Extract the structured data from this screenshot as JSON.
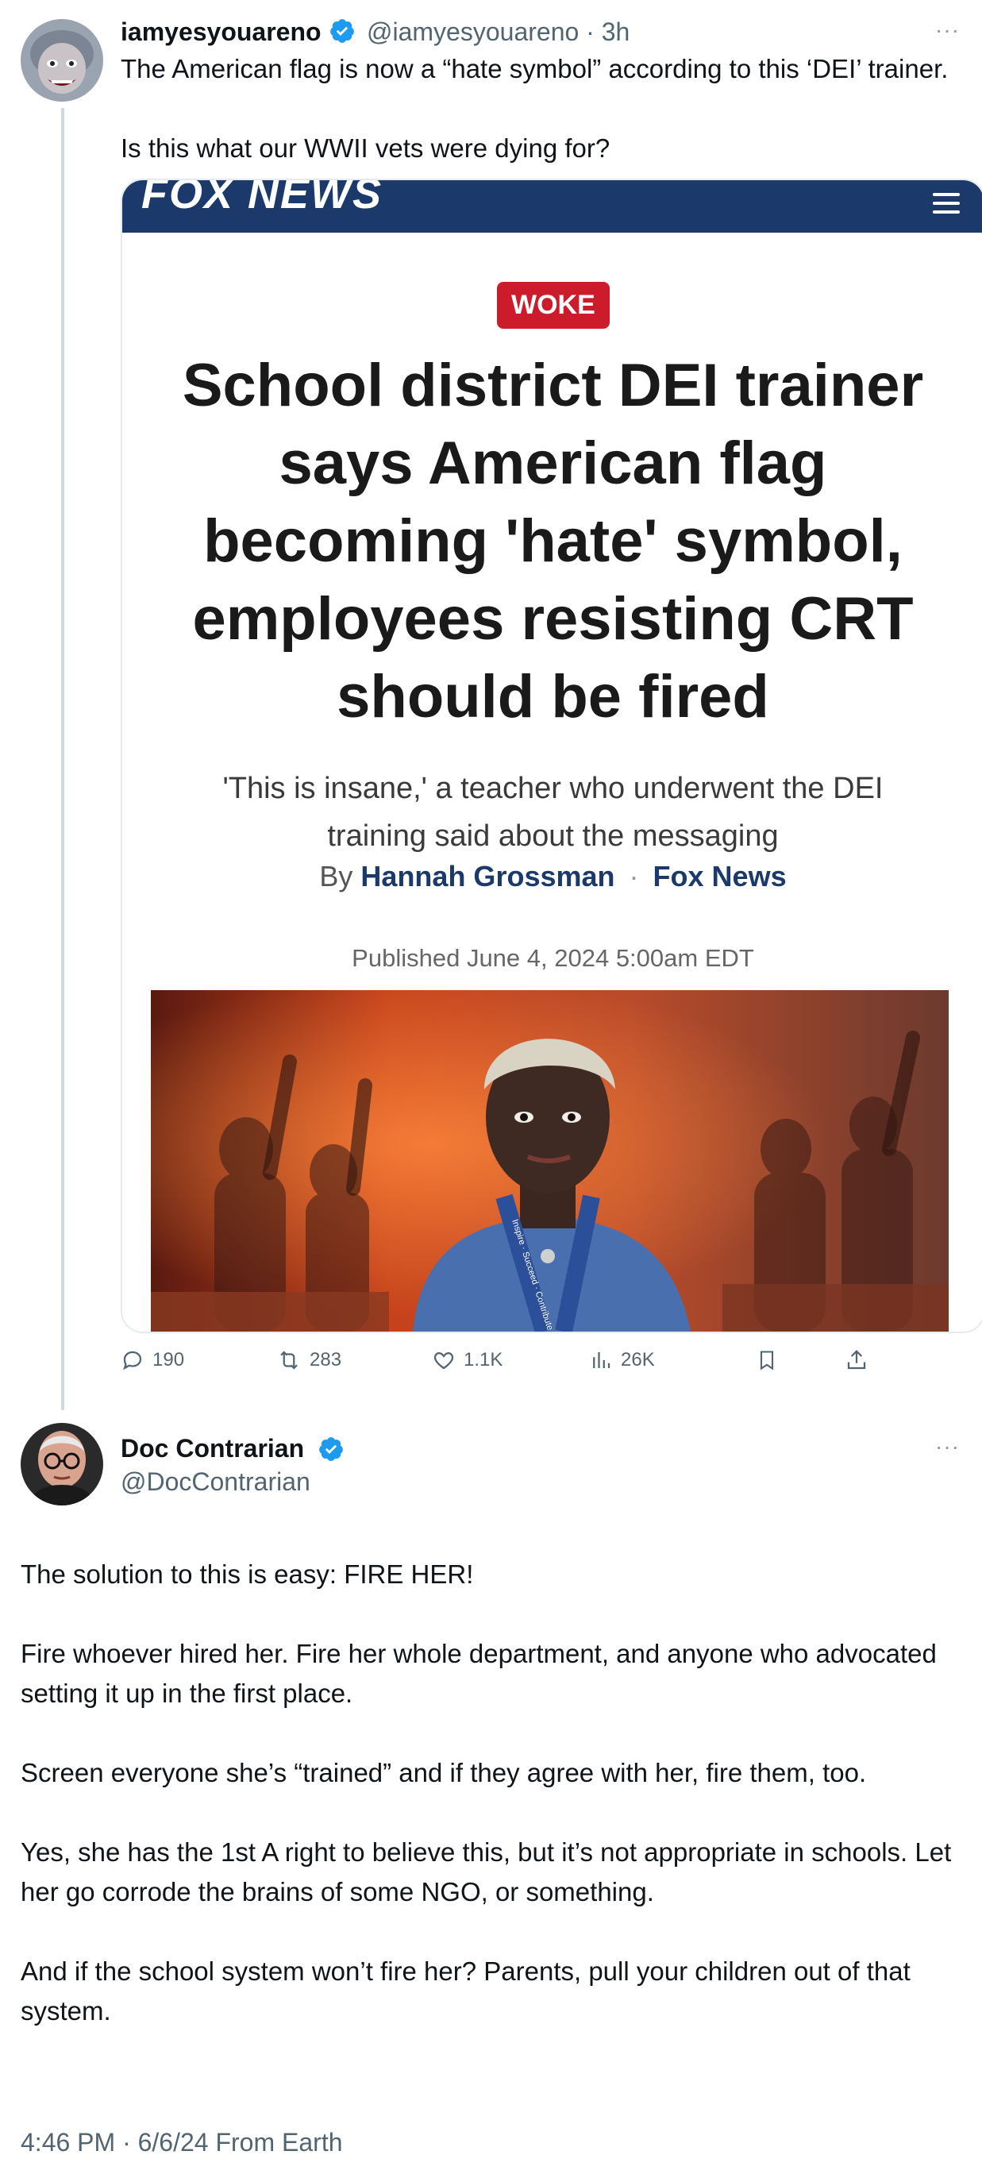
{
  "tweet1": {
    "name": "iamyesyouareno",
    "handle": "@iamyesyouareno",
    "separator": "·",
    "time": "3h",
    "text": "The American flag is now a “hate symbol” according to this ‘DEI’ trainer.\n\nIs this what our WWII vets were dying for?",
    "more_label": "···"
  },
  "embed": {
    "outlet_logo": "FOX NEWS",
    "tag": "WOKE",
    "headline": "School district DEI trainer says American flag becoming 'hate' symbol, employees resisting CRT should be fired",
    "subhead": "'This is insane,' a teacher who underwent the DEI training said about the messaging",
    "by": "By",
    "author": "Hannah Grossman",
    "dot": "·",
    "outlet": "Fox News",
    "published": "Published June 4, 2024 5:00am EDT",
    "lanyard_text": "Inspire · Succeed · Contribute"
  },
  "actions": {
    "replies": "190",
    "reposts": "283",
    "likes": "1.1K",
    "views": "26K"
  },
  "tweet2": {
    "name": "Doc Contrarian",
    "handle": "@DocContrarian",
    "more_label": "···",
    "text": "The solution to this is easy: FIRE HER!\n\nFire whoever hired her. Fire her whole department, and anyone who advocated setting it up in the first place.\n\nScreen everyone she’s “trained” and if they agree with her, fire them, too.\n\nYes, she has the 1st A right to believe this, but it’s not appropriate in schools. Let her go corrode the brains of some NGO, or something.\n\nAnd if the school system won’t fire her? Parents, pull your children out of that system.",
    "meta": "4:46 PM · 6/6/24 From Earth"
  },
  "colors": {
    "verified": "#1d9bf0",
    "fox_navy": "#1b3a6b",
    "woke_red": "#cc1b2b",
    "muted": "#536471"
  }
}
